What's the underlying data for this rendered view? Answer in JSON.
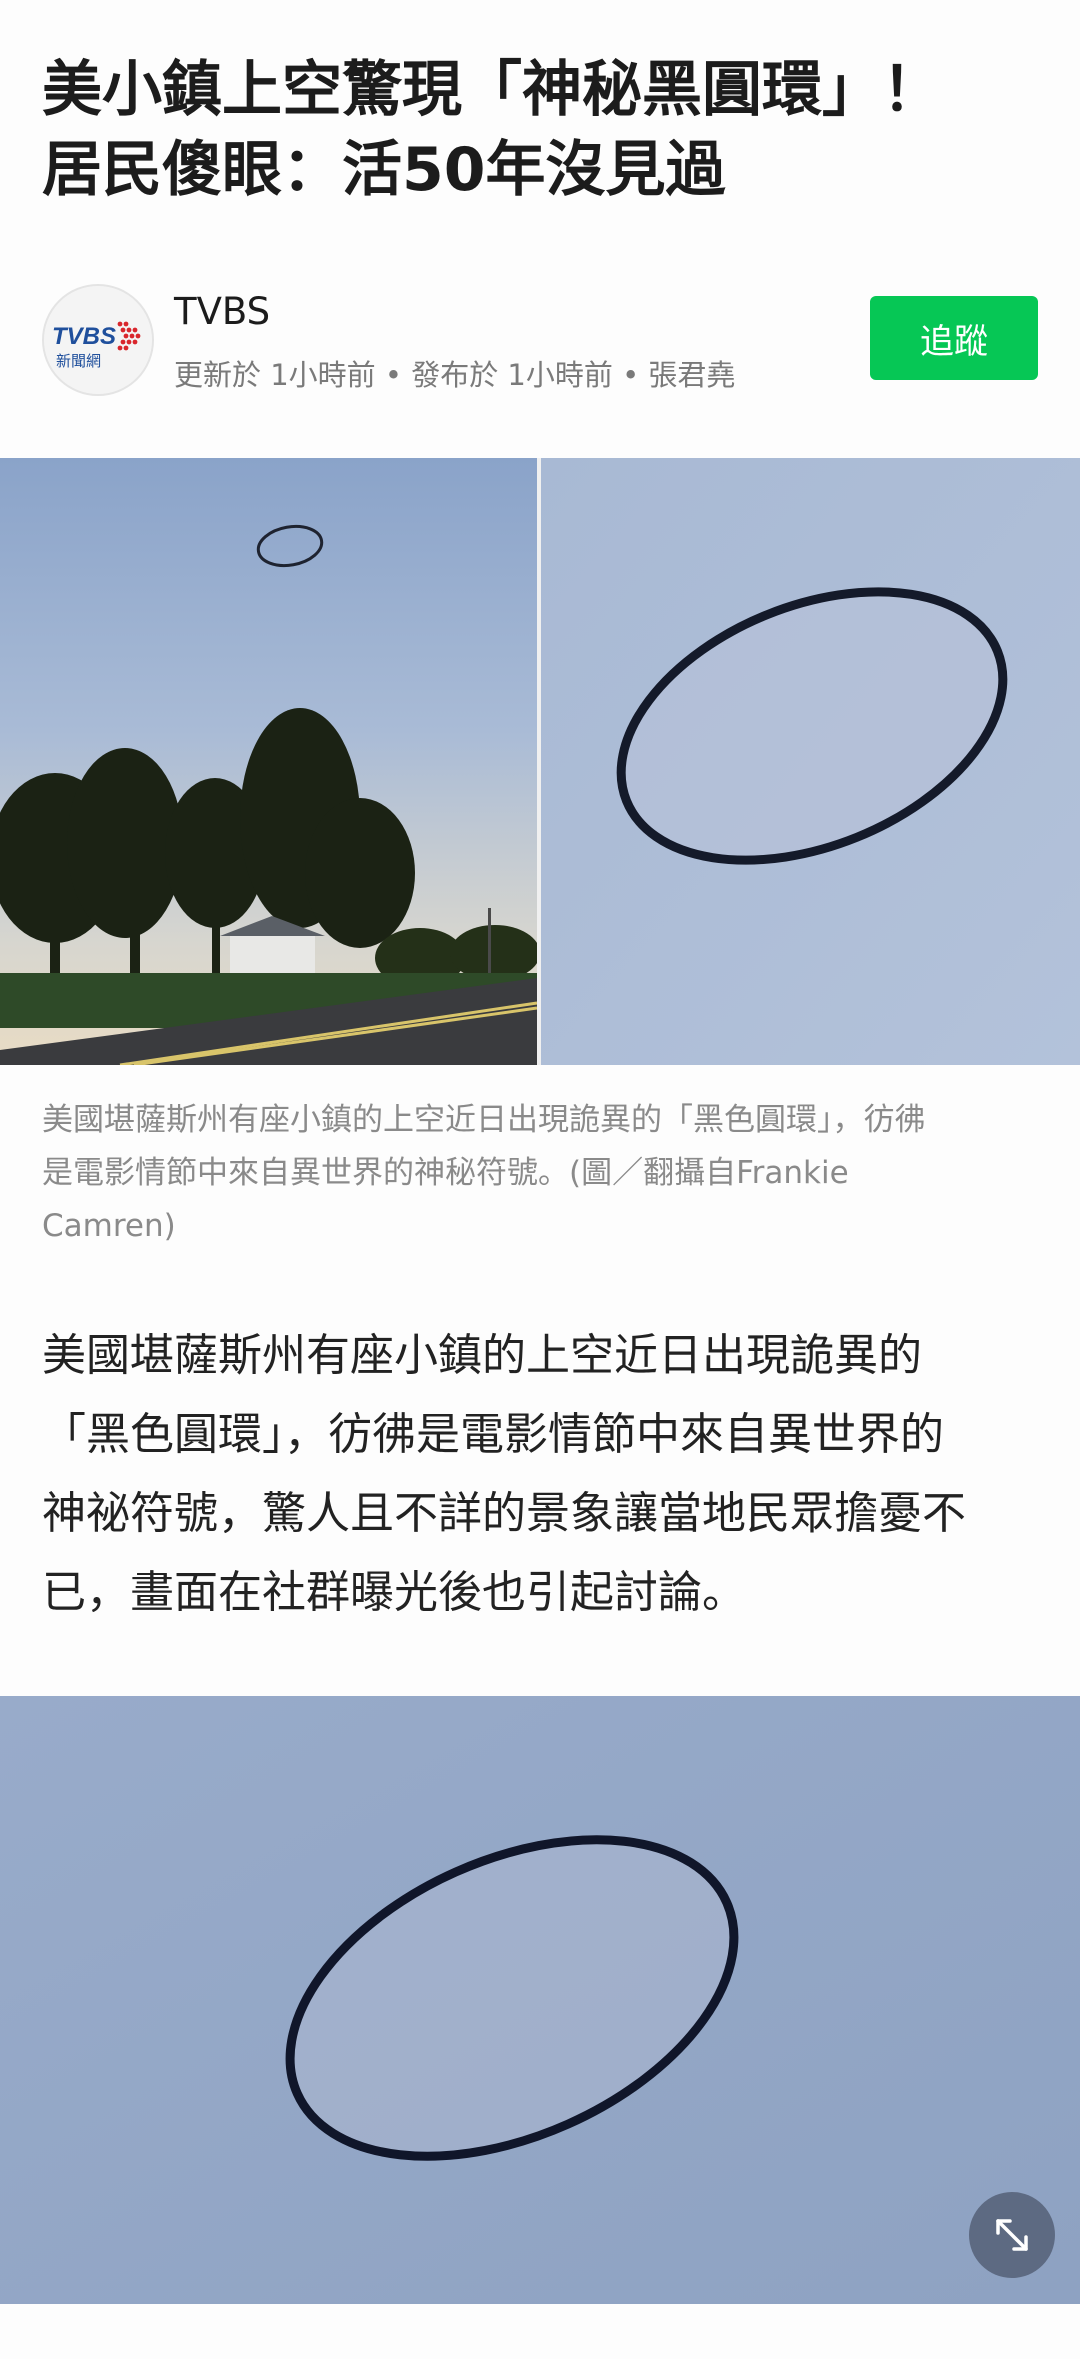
{
  "article": {
    "headline_lines": [
      "美小鎮上空驚現「神秘黑圓環」！",
      "居民傻眼：活50年沒見過"
    ]
  },
  "source": {
    "name": "TVBS",
    "logo_text": "TVBS",
    "logo_subtext": "新聞網",
    "meta": "更新於 1小時前 • 發布於 1小時前 • 張君堯",
    "follow_label": "追蹤"
  },
  "hero_image": {
    "caption_lines": [
      "美國堪薩斯州有座小鎮的上空近日出現詭異的「黑色圓環」，彷彿",
      "是電影情節中來自異世界的神秘符號。(圖／翻攝自Frankie",
      "Camren)"
    ]
  },
  "body": {
    "paragraph_lines": [
      "美國堪薩斯州有座小鎮的上空近日出現詭異的",
      "「黑色圓環」，彷彿是電影情節中來自異世界的",
      "神祕符號，驚人且不詳的景象讓當地民眾擔憂不",
      "已，畫面在社群曝光後也引起討論。"
    ]
  },
  "second_image": {
    "expand_icon": "expand-arrows-icon"
  },
  "colors": {
    "follow_button": "#06c755",
    "meta_text": "#7a7a7a",
    "caption_text": "#8a8a8a",
    "sky_blue": "#a9bbd6"
  }
}
